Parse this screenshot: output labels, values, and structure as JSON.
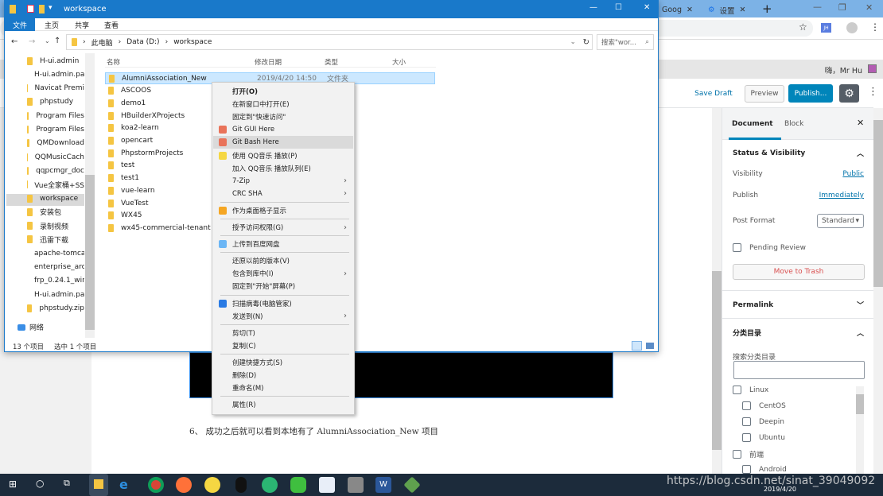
{
  "chrome": {
    "tabs": [
      {
        "label": "Goog"
      },
      {
        "label": "设置"
      }
    ],
    "new_tab": "+",
    "profile_badge": "JH",
    "star": "☆",
    "menu": "⋮"
  },
  "wp": {
    "greeting": "嗨，Mr Hu",
    "save_draft": "Save Draft",
    "preview": "Preview",
    "publish": "Publish...",
    "sidebar": {
      "tab_document": "Document",
      "tab_block": "Block",
      "status_title": "Status & Visibility",
      "visibility_label": "Visibility",
      "visibility_value": "Public",
      "publish_label": "Publish",
      "publish_value": "Immediately",
      "post_format_label": "Post Format",
      "post_format_value": "Standard",
      "pending_review": "Pending Review",
      "move_to_trash": "Move to Trash",
      "permalink": "Permalink",
      "categories_title": "分类目录",
      "search_categories": "搜索分类目录",
      "categories": [
        {
          "label": "Linux",
          "level": 0
        },
        {
          "label": "CentOS",
          "level": 1
        },
        {
          "label": "Deepin",
          "level": 1
        },
        {
          "label": "Ubuntu",
          "level": 1
        },
        {
          "label": "前端",
          "level": 0
        },
        {
          "label": "Android",
          "level": 1
        }
      ]
    },
    "content_text": "6、 成功之后就可以看到本地有了 AlumniAssociation_New 项目"
  },
  "explorer": {
    "title": "workspace",
    "ribbon_tabs": [
      "文件",
      "主页",
      "共享",
      "查看"
    ],
    "breadcrumb": [
      "此电脑",
      "Data (D:)",
      "workspace"
    ],
    "search_placeholder": "搜索\"wor...",
    "nav_items": [
      "H-ui.admin",
      "H-ui.admin.pa",
      "Navicat Premi",
      "phpstudy",
      "Program Files",
      "Program Files",
      "QMDownload",
      "QQMusicCach",
      "qqpcmgr_doc",
      "Vue全家桶+SS",
      "workspace",
      "安装包",
      "录制视频",
      "迅雷下载",
      "apache-tomca",
      "enterprise_arc",
      "frp_0.24.1_wir",
      "H-ui.admin.pa",
      "phpstudy.zip"
    ],
    "network": "网络",
    "columns": [
      "名称",
      "修改日期",
      "类型",
      "大小"
    ],
    "files": [
      {
        "name": "AlumniAssociation_New",
        "date": "2019/4/20 14:50",
        "type": "文件夹"
      },
      {
        "name": "ASCOOS"
      },
      {
        "name": "demo1"
      },
      {
        "name": "HBuilderXProjects"
      },
      {
        "name": "koa2-learn"
      },
      {
        "name": "opencart"
      },
      {
        "name": "PhpstormProjects"
      },
      {
        "name": "test"
      },
      {
        "name": "test1"
      },
      {
        "name": "vue-learn"
      },
      {
        "name": "VueTest"
      },
      {
        "name": "WX45"
      },
      {
        "name": "wx45-commercial-tenant"
      }
    ],
    "status_count": "13 个项目",
    "status_selected": "选中 1 个项目"
  },
  "context_menu": [
    {
      "label": "打开(O)",
      "bold": true
    },
    {
      "label": "在新窗口中打开(E)"
    },
    {
      "label": "固定到\"快速访问\""
    },
    {
      "label": "Git GUI Here",
      "icon": "git-icon"
    },
    {
      "label": "Git Bash Here",
      "icon": "git-icon",
      "hover": true
    },
    {
      "label": "使用 QQ音乐 播放(P)",
      "icon": "qqmusic-icon"
    },
    {
      "label": "加入 QQ音乐 播放队列(E)"
    },
    {
      "label": "7-Zip",
      "sub": true
    },
    {
      "label": "CRC SHA",
      "sub": true
    },
    "sep",
    {
      "label": "作为桌面格子显示",
      "icon": "grid-icon"
    },
    "sep",
    {
      "label": "授予访问权限(G)",
      "sub": true
    },
    "sep",
    {
      "label": "上传到百度网盘",
      "icon": "baidu-cloud-icon"
    },
    "sep",
    {
      "label": "还原以前的版本(V)"
    },
    {
      "label": "包含到库中(I)",
      "sub": true
    },
    {
      "label": "固定到\"开始\"屏幕(P)"
    },
    "sep",
    {
      "label": "扫描病毒(电脑管家)",
      "icon": "shield-icon"
    },
    {
      "label": "发送到(N)",
      "sub": true
    },
    "sep",
    {
      "label": "剪切(T)"
    },
    {
      "label": "复制(C)"
    },
    "sep",
    {
      "label": "创建快捷方式(S)"
    },
    {
      "label": "删除(D)"
    },
    {
      "label": "重命名(M)"
    },
    "sep",
    {
      "label": "属性(R)"
    }
  ],
  "taskbar": {
    "date": "2019/4/20",
    "watermark": "https://blog.csdn.net/sinat_39049092"
  },
  "colors": {
    "explorer_blue": "#1979ca",
    "wp_primary": "#0085ba",
    "taskbar": "#1c2b3b",
    "trash_red": "#d94f4f"
  }
}
